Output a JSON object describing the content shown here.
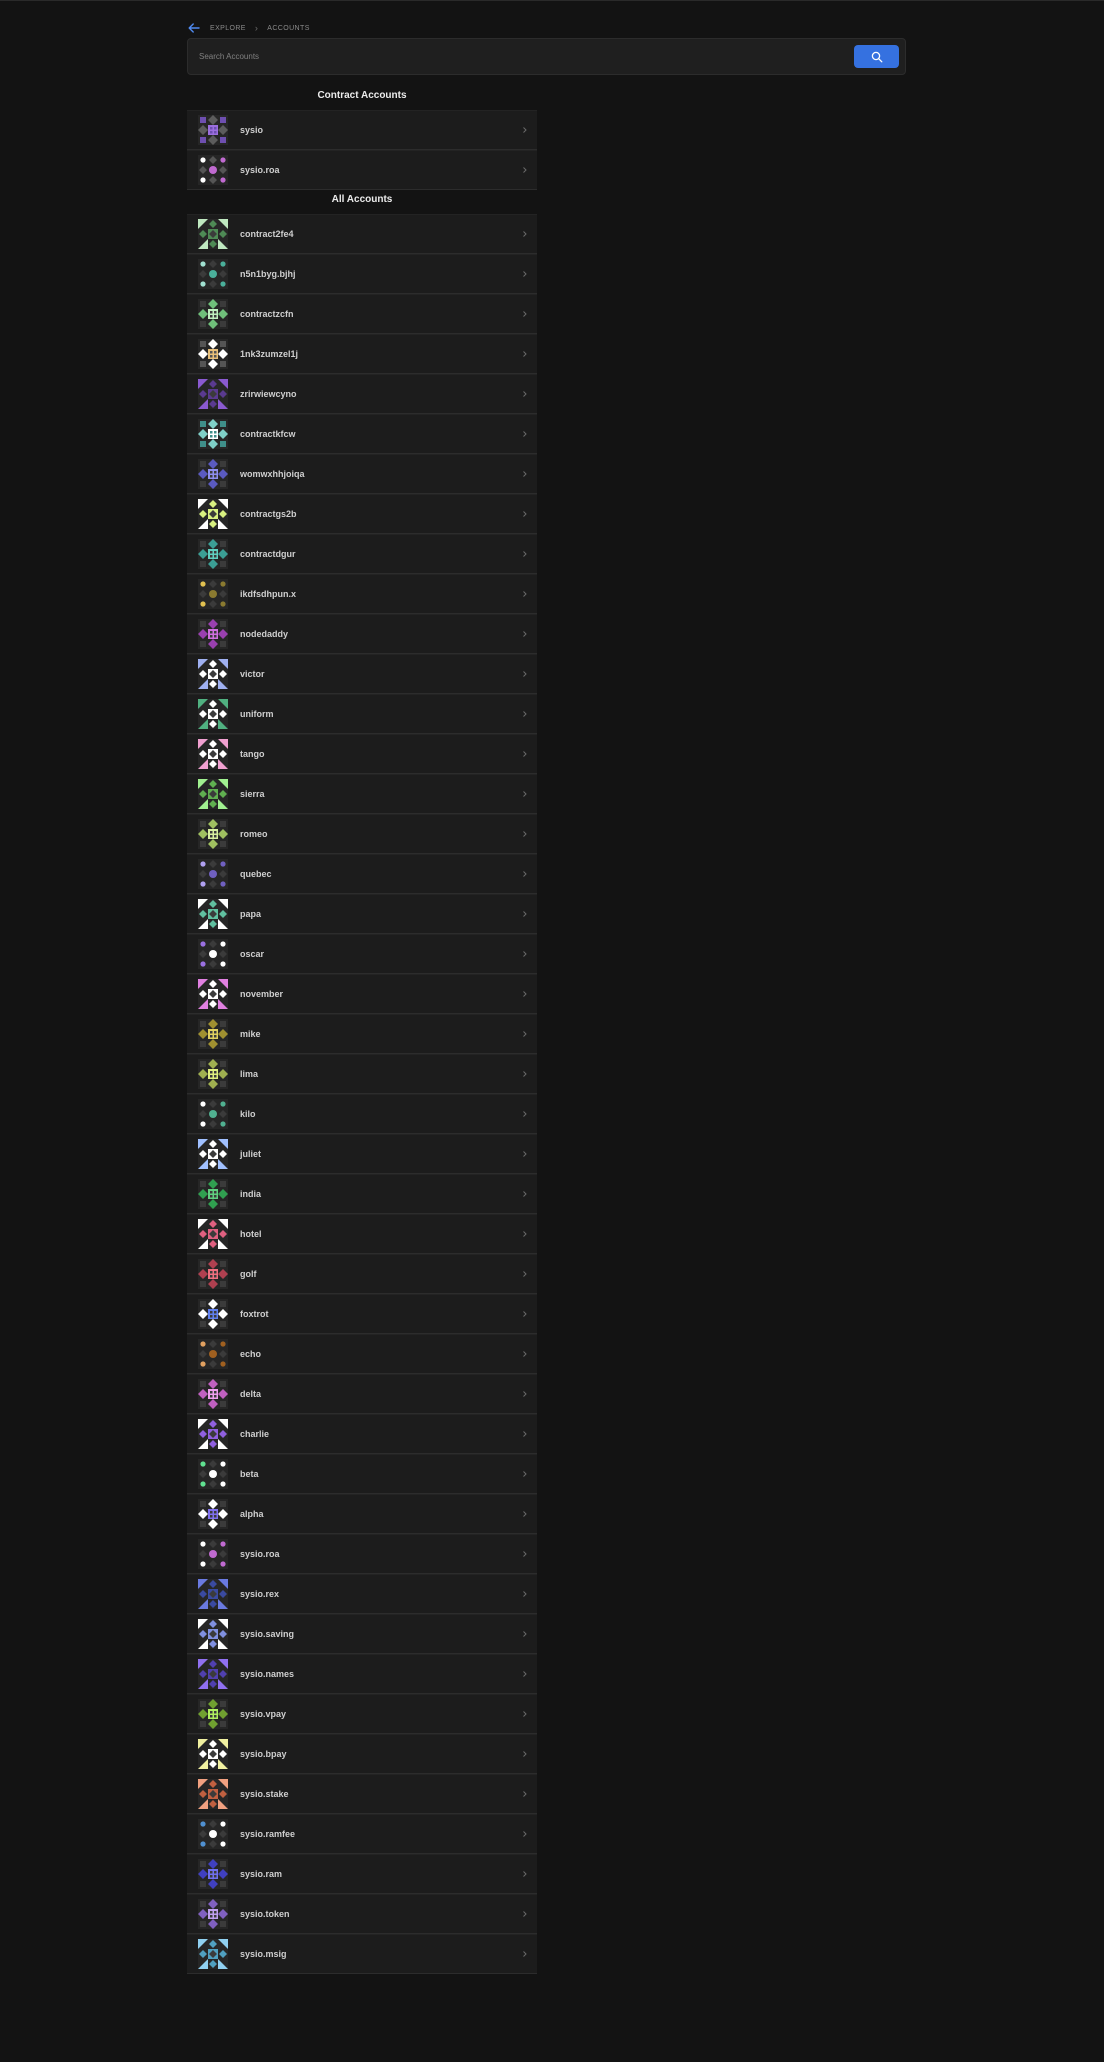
{
  "nav": {
    "back_icon": "arrow-left-icon",
    "crumbs": [
      "EXPLORE",
      "ACCOUNTS"
    ]
  },
  "search": {
    "placeholder": "Search Accounts",
    "value": "",
    "button_icon": "search-icon",
    "button_color": "#3571e0"
  },
  "contract_section": {
    "title": "Contract Accounts",
    "accounts": [
      {
        "name": "sysio",
        "colors": [
          "#9c6fde",
          "#5c5c5c",
          "#6e4fb0"
        ],
        "style": "grid"
      },
      {
        "name": "sysio.roa",
        "colors": [
          "#ffffff",
          "#c06ad0",
          "#555555"
        ],
        "style": "dots"
      }
    ]
  },
  "all_section": {
    "title": "All Accounts",
    "accounts": [
      {
        "name": "contract2fe4",
        "colors": [
          "#bfe8c0",
          "#4e8a55",
          "#3b3b3b"
        ],
        "style": "tri"
      },
      {
        "name": "n5n1byg.bjhj",
        "colors": [
          "#a0e0d0",
          "#4aaf9a",
          "#3b3b3b"
        ],
        "style": "dots"
      },
      {
        "name": "contractzcfn",
        "colors": [
          "#bff0bf",
          "#6fbf7a",
          "#3b3b3b"
        ],
        "style": "grid"
      },
      {
        "name": "1nk3zumzel1j",
        "colors": [
          "#e8c07a",
          "#ffffff",
          "#555555"
        ],
        "style": "grid"
      },
      {
        "name": "zrirwiewcyno",
        "colors": [
          "#8a5ad0",
          "#5a3a90",
          "#3b3b3b"
        ],
        "style": "tri"
      },
      {
        "name": "contractkfcw",
        "colors": [
          "#ffffff",
          "#7fd0c8",
          "#3f8f8a"
        ],
        "style": "grid"
      },
      {
        "name": "womwxhhjoiqa",
        "colors": [
          "#8f8ff0",
          "#5a5ac0",
          "#3b3b3b"
        ],
        "style": "grid"
      },
      {
        "name": "contractgs2b",
        "colors": [
          "#ffffff",
          "#d8f080",
          "#3b3b3b"
        ],
        "style": "tri"
      },
      {
        "name": "contractdgur",
        "colors": [
          "#60d0c0",
          "#3b9f95",
          "#3b3b3b"
        ],
        "style": "grid"
      },
      {
        "name": "ikdfsdhpun.x",
        "colors": [
          "#e0c050",
          "#8a7a30",
          "#3b3b3b"
        ],
        "style": "dots"
      },
      {
        "name": "nodedaddy",
        "colors": [
          "#d070e0",
          "#9a40b0",
          "#3b3b3b"
        ],
        "style": "grid"
      },
      {
        "name": "victor",
        "colors": [
          "#9fb0f0",
          "#ffffff",
          "#3b3b3b"
        ],
        "style": "tri"
      },
      {
        "name": "uniform",
        "colors": [
          "#50b080",
          "#ffffff",
          "#3b3b3b"
        ],
        "style": "tri"
      },
      {
        "name": "tango",
        "colors": [
          "#f0a0d0",
          "#ffffff",
          "#3b3b3b"
        ],
        "style": "tri"
      },
      {
        "name": "sierra",
        "colors": [
          "#a0f090",
          "#60b050",
          "#3b3b3b"
        ],
        "style": "tri"
      },
      {
        "name": "romeo",
        "colors": [
          "#d8f0a0",
          "#a0c060",
          "#3b3b3b"
        ],
        "style": "grid"
      },
      {
        "name": "quebec",
        "colors": [
          "#b0a0f0",
          "#7060c0",
          "#3b3b3b"
        ],
        "style": "dots"
      },
      {
        "name": "papa",
        "colors": [
          "#ffffff",
          "#60c0a0",
          "#3b3b3b"
        ],
        "style": "tri"
      },
      {
        "name": "oscar",
        "colors": [
          "#9a70e0",
          "#ffffff",
          "#3b3b3b"
        ],
        "style": "dots"
      },
      {
        "name": "november",
        "colors": [
          "#e080e0",
          "#ffffff",
          "#3b3b3b"
        ],
        "style": "tri"
      },
      {
        "name": "mike",
        "colors": [
          "#e0d060",
          "#a09030",
          "#3b3b3b"
        ],
        "style": "grid"
      },
      {
        "name": "lima",
        "colors": [
          "#e0f080",
          "#a0b050",
          "#3b3b3b"
        ],
        "style": "grid"
      },
      {
        "name": "kilo",
        "colors": [
          "#ffffff",
          "#50b090",
          "#3b3b3b"
        ],
        "style": "dots"
      },
      {
        "name": "juliet",
        "colors": [
          "#a0c0ff",
          "#ffffff",
          "#3b3b3b"
        ],
        "style": "tri"
      },
      {
        "name": "india",
        "colors": [
          "#60d080",
          "#30a050",
          "#3b3b3b"
        ],
        "style": "grid"
      },
      {
        "name": "hotel",
        "colors": [
          "#ffffff",
          "#e06080",
          "#3b3b3b"
        ],
        "style": "tri"
      },
      {
        "name": "golf",
        "colors": [
          "#f07080",
          "#b04050",
          "#3b3b3b"
        ],
        "style": "grid"
      },
      {
        "name": "foxtrot",
        "colors": [
          "#6080f0",
          "#ffffff",
          "#3b3b3b"
        ],
        "style": "grid"
      },
      {
        "name": "echo",
        "colors": [
          "#e0a060",
          "#a06020",
          "#3b3b3b"
        ],
        "style": "dots"
      },
      {
        "name": "delta",
        "colors": [
          "#f0a0f0",
          "#c060c0",
          "#3b3b3b"
        ],
        "style": "grid"
      },
      {
        "name": "charlie",
        "colors": [
          "#ffffff",
          "#9060e0",
          "#3b3b3b"
        ],
        "style": "tri"
      },
      {
        "name": "beta",
        "colors": [
          "#60e090",
          "#ffffff",
          "#3b3b3b"
        ],
        "style": "dots"
      },
      {
        "name": "alpha",
        "colors": [
          "#8070f0",
          "#ffffff",
          "#3b3b3b"
        ],
        "style": "grid"
      },
      {
        "name": "sysio.roa",
        "colors": [
          "#ffffff",
          "#c06ad0",
          "#3b3b3b"
        ],
        "style": "dots"
      },
      {
        "name": "sysio.rex",
        "colors": [
          "#6a7ae0",
          "#3a4aa0",
          "#3b3b3b"
        ],
        "style": "tri"
      },
      {
        "name": "sysio.saving",
        "colors": [
          "#ffffff",
          "#8090e0",
          "#3b3b3b"
        ],
        "style": "tri"
      },
      {
        "name": "sysio.names",
        "colors": [
          "#9070f0",
          "#5040b0",
          "#3b3b3b"
        ],
        "style": "tri"
      },
      {
        "name": "sysio.vpay",
        "colors": [
          "#b0f060",
          "#70a030",
          "#3b3b3b"
        ],
        "style": "grid"
      },
      {
        "name": "sysio.bpay",
        "colors": [
          "#f0f0a0",
          "#ffffff",
          "#3b3b3b"
        ],
        "style": "tri"
      },
      {
        "name": "sysio.stake",
        "colors": [
          "#f0a080",
          "#c06040",
          "#3b3b3b"
        ],
        "style": "tri"
      },
      {
        "name": "sysio.ramfee",
        "colors": [
          "#5090d0",
          "#ffffff",
          "#3b3b3b"
        ],
        "style": "dots"
      },
      {
        "name": "sysio.ram",
        "colors": [
          "#7070f0",
          "#4040c0",
          "#3b3b3b"
        ],
        "style": "grid"
      },
      {
        "name": "sysio.token",
        "colors": [
          "#c0a0f0",
          "#8060c0",
          "#3b3b3b"
        ],
        "style": "grid"
      },
      {
        "name": "sysio.msig",
        "colors": [
          "#90d0f0",
          "#50a0c0",
          "#3b3b3b"
        ],
        "style": "tri"
      }
    ]
  },
  "row_chevron_icon": "chevron-right-icon"
}
